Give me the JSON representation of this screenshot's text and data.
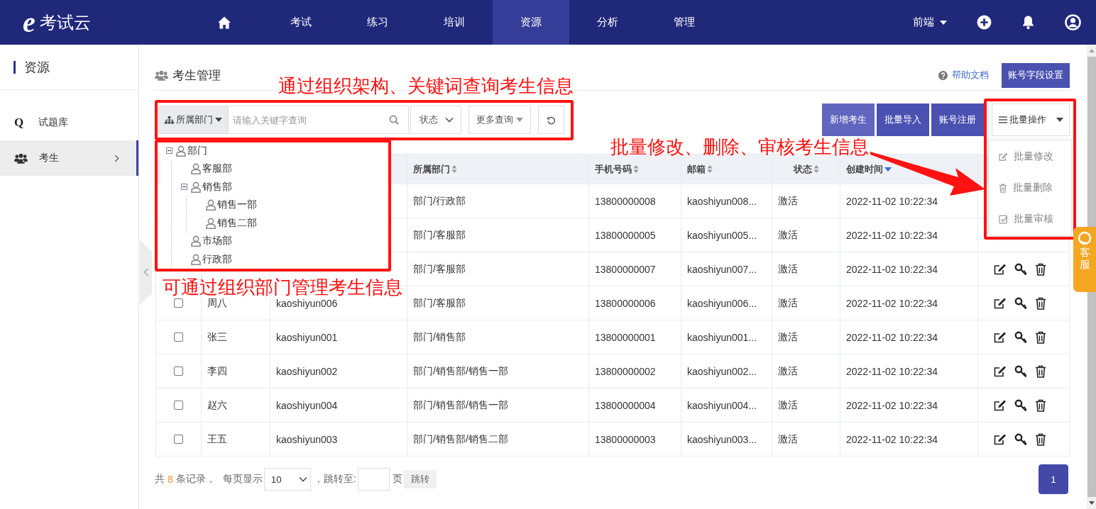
{
  "header": {
    "logo_mark": "e",
    "logo": "考试云",
    "nav": [
      {
        "kind": "home",
        "selected": false
      },
      {
        "kind": "text",
        "label": "考试",
        "selected": false
      },
      {
        "kind": "text",
        "label": "练习",
        "selected": false
      },
      {
        "kind": "text",
        "label": "培训",
        "selected": false
      },
      {
        "kind": "text",
        "label": "资源",
        "selected": true
      },
      {
        "kind": "text",
        "label": "分析",
        "selected": false
      },
      {
        "kind": "text",
        "label": "管理",
        "selected": false
      }
    ],
    "user_menu": "前端"
  },
  "sidebar": {
    "title": "资源",
    "items": [
      {
        "label": "试题库",
        "kind": "letter",
        "glyph": "Q",
        "selected": false
      },
      {
        "label": "考生",
        "kind": "people",
        "selected": true
      }
    ]
  },
  "page": {
    "title": "考生管理",
    "help_link": "帮助文档",
    "settings_button": "账号字段设置"
  },
  "filters": {
    "department": "所属部门",
    "search": {
      "placeholder": "请输入关键字查询"
    },
    "status": "状态",
    "more": "更多查询"
  },
  "toolbar": {
    "buttons": [
      "新增考生",
      "批量导入",
      "账号注册"
    ],
    "batch": "批量操作"
  },
  "batch_menu": [
    {
      "label": "批量修改",
      "kind": "edit"
    },
    {
      "label": "批量删除",
      "kind": "delete"
    },
    {
      "label": "批量审核",
      "kind": "approve"
    }
  ],
  "department_tree": [
    {
      "label": "部门",
      "expanded": true,
      "children": [
        {
          "label": "客服部"
        },
        {
          "label": "销售部",
          "expanded": true,
          "children": [
            {
              "label": "销售一部"
            },
            {
              "label": "销售二部"
            }
          ]
        },
        {
          "label": "市场部"
        },
        {
          "label": "行政部"
        }
      ]
    }
  ],
  "table": {
    "columns": [
      {
        "label": "所属部门",
        "sorted_descending": false
      },
      {
        "label": "手机号码",
        "sorted_descending": false
      },
      {
        "label": "邮箱",
        "sorted_descending": false
      },
      {
        "label": "状态",
        "sorted_descending": false
      },
      {
        "label": "创建时间",
        "sorted_descending": true
      }
    ],
    "rows": [
      {
        "department": "部门/行政部",
        "phone": "13800000008",
        "email": "kaoshiyun008...",
        "status": "激活",
        "created": "2022-11-02 10:22:34"
      },
      {
        "department": "部门/客服部",
        "phone": "13800000005",
        "email": "kaoshiyun005...",
        "status": "激活",
        "created": "2022-11-02 10:22:34"
      },
      {
        "department": "部门/客服部",
        "phone": "13800000007",
        "email": "kaoshiyun007...",
        "status": "激活",
        "created": "2022-11-02 10:22:34",
        "actions": true
      },
      {
        "checked": false,
        "name": "周八",
        "account": "kaoshiyun006",
        "department": "部门/客服部",
        "phone": "13800000006",
        "email": "kaoshiyun006...",
        "status": "激活",
        "created": "2022-11-02 10:22:34",
        "actions": true
      },
      {
        "checked": false,
        "name": "张三",
        "account": "kaoshiyun001",
        "department": "部门/销售部",
        "phone": "13800000001",
        "email": "kaoshiyun001...",
        "status": "激活",
        "created": "2022-11-02 10:22:34",
        "actions": true
      },
      {
        "checked": false,
        "name": "李四",
        "account": "kaoshiyun002",
        "department": "部门/销售部/销售一部",
        "phone": "13800000002",
        "email": "kaoshiyun002...",
        "status": "激活",
        "created": "2022-11-02 10:22:34",
        "actions": true
      },
      {
        "checked": false,
        "name": "赵六",
        "account": "kaoshiyun004",
        "department": "部门/销售部/销售一部",
        "phone": "13800000004",
        "email": "kaoshiyun004...",
        "status": "激活",
        "created": "2022-11-02 10:22:34",
        "actions": true
      },
      {
        "checked": false,
        "name": "王五",
        "account": "kaoshiyun003",
        "department": "部门/销售部/销售二部",
        "phone": "13800000003",
        "email": "kaoshiyun003...",
        "status": "激活",
        "created": "2022-11-02 10:22:34",
        "actions": true
      }
    ]
  },
  "pagination": {
    "prefix": "共",
    "total": "8",
    "suffix": "条记录，",
    "page_size_label": "每页显示",
    "page_size": "10",
    "jump_label": "，跳转至:",
    "page_unit": "页",
    "jump_button": "跳转",
    "pages": [
      {
        "label": "1",
        "selected": true
      }
    ]
  },
  "annotations": [
    {
      "text": "通过组织架构、关键词查询考生信息"
    },
    {
      "text": "可通过组织部门管理考生信息"
    },
    {
      "text": "批量修改、删除、审核考生信息"
    }
  ],
  "support_tab": "客服"
}
